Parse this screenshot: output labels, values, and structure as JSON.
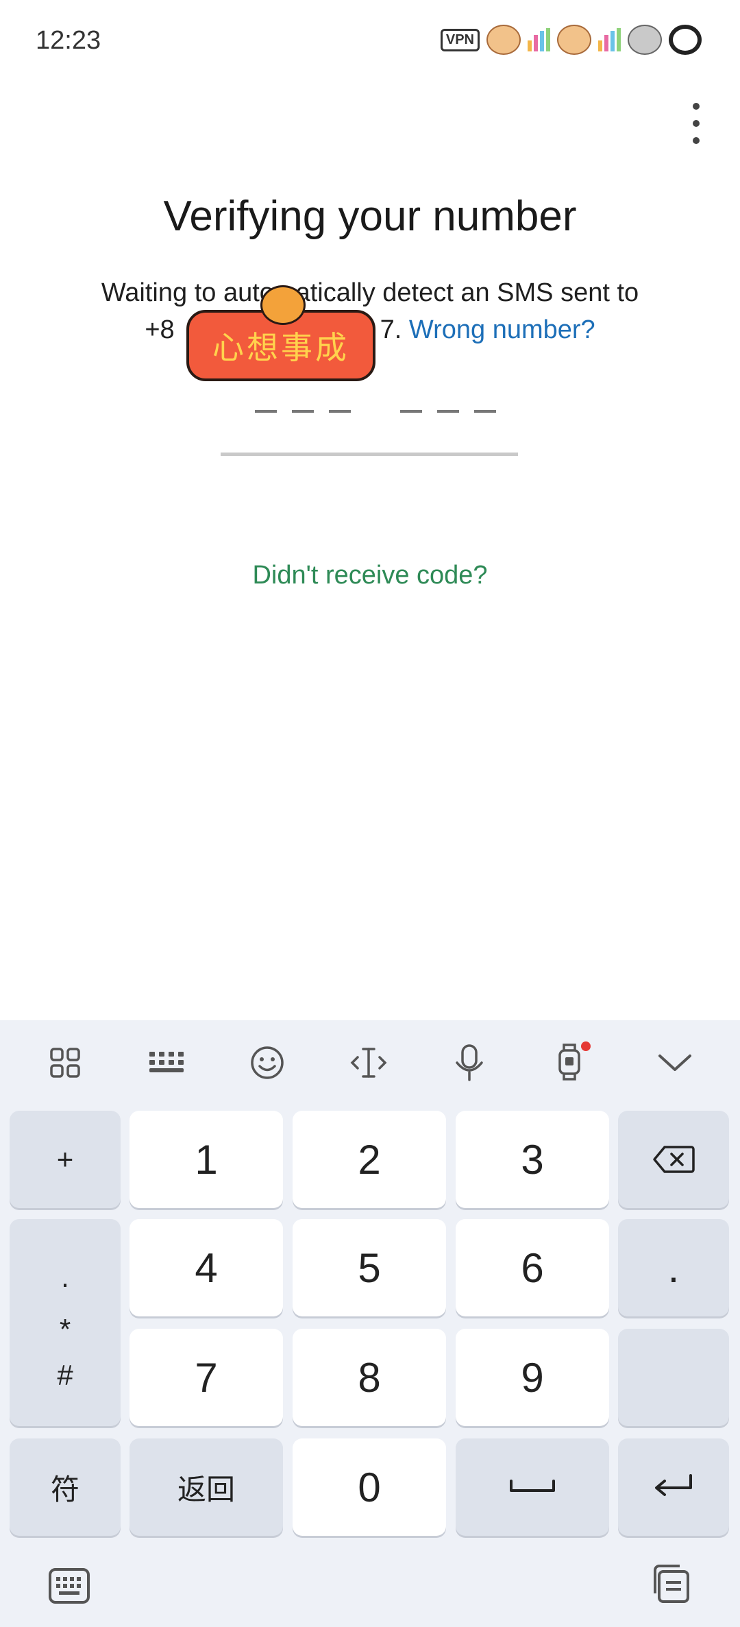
{
  "status_bar": {
    "time": "12:23",
    "vpn": "VPN"
  },
  "header": {
    "title": "Verifying your number"
  },
  "message": {
    "line1": "Waiting to automatically detect an SMS sent to",
    "number_prefix": "+8",
    "number_suffix": "7.",
    "wrong_number": "Wrong number?"
  },
  "sticker": {
    "text": "心想事成"
  },
  "resend": {
    "label": "Didn't receive code?"
  },
  "keyboard": {
    "toolbar_icons": [
      "apps-grid-icon",
      "keyboard-layout-icon",
      "emoji-icon",
      "cursor-icon",
      "microphone-icon",
      "watch-ai-icon",
      "collapse-chevron-icon"
    ],
    "keys": {
      "plus": "+",
      "dot_small": "·",
      "star": "*",
      "hash": "#",
      "symbols": "符",
      "back": "返回",
      "k1": "1",
      "k2": "2",
      "k3": "3",
      "k4": "4",
      "k5": "5",
      "k6": "6",
      "k7": "7",
      "k8": "8",
      "k9": "9",
      "k0": "0",
      "period": "."
    }
  },
  "colors": {
    "link": "#1d6fb8",
    "resend": "#2e8a56",
    "keyboard_bg": "#eef1f7",
    "badge_dot": "#e53935"
  }
}
